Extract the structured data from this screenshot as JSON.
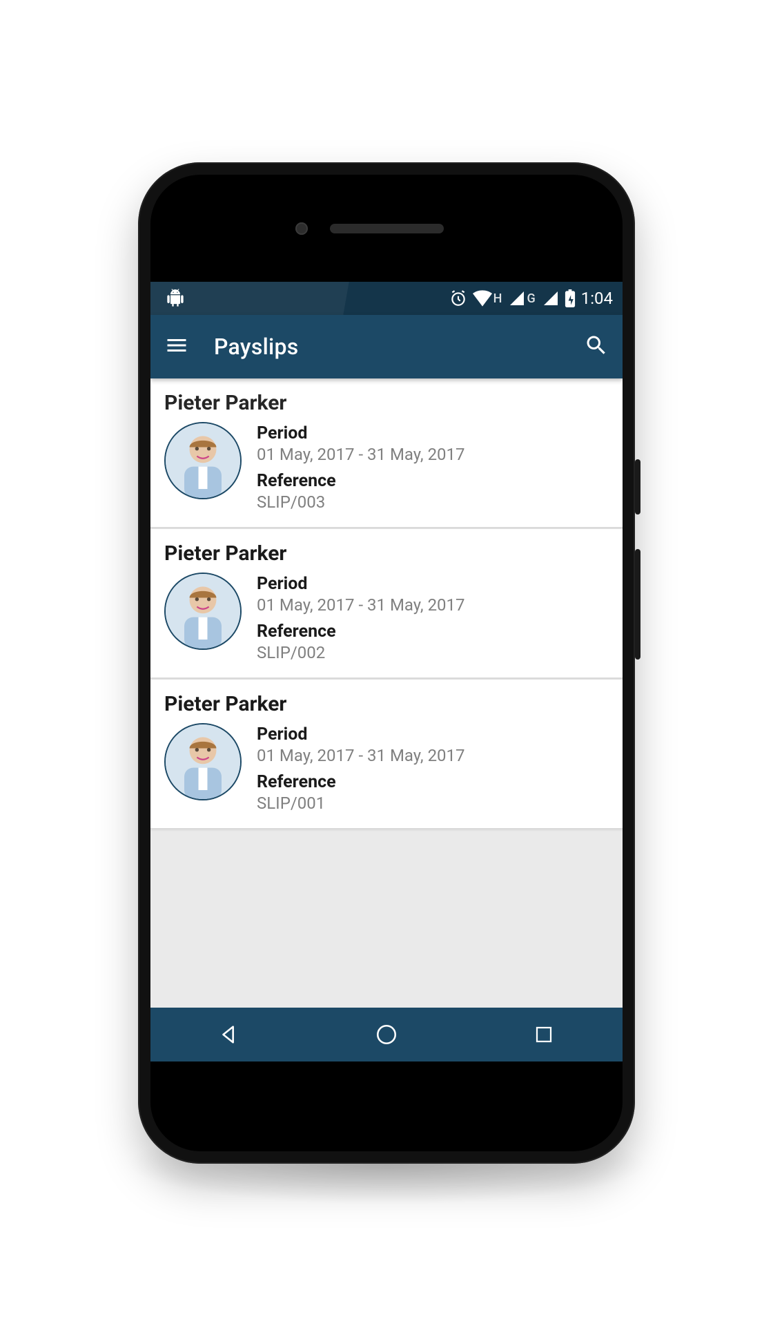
{
  "status": {
    "time": "1:04",
    "net1_letter": "H",
    "net2_letter": "G"
  },
  "appbar": {
    "title": "Payslips"
  },
  "labels": {
    "period": "Period",
    "reference": "Reference"
  },
  "payslips": [
    {
      "name": "Pieter Parker",
      "period": "01 May, 2017 - 31 May, 2017",
      "reference": "SLIP/003"
    },
    {
      "name": "Pieter Parker",
      "period": "01 May, 2017 - 31 May, 2017",
      "reference": "SLIP/002"
    },
    {
      "name": "Pieter Parker",
      "period": "01 May, 2017 - 31 May, 2017",
      "reference": "SLIP/001"
    }
  ]
}
